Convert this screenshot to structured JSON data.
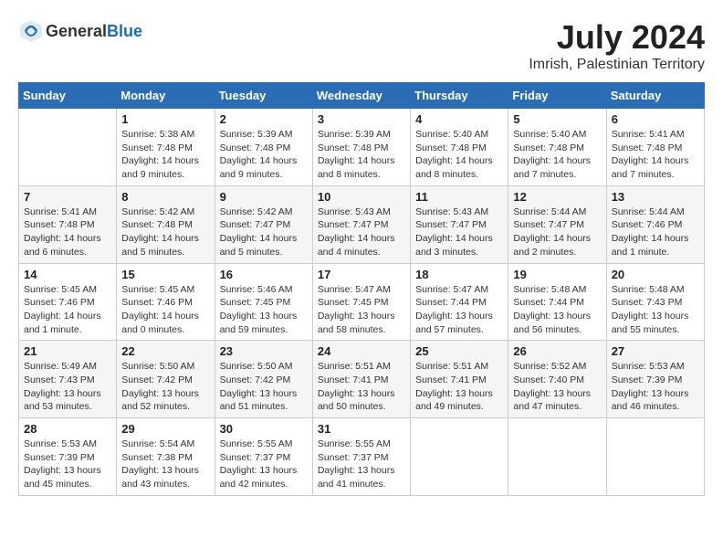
{
  "header": {
    "logo_general": "General",
    "logo_blue": "Blue",
    "month_year": "July 2024",
    "location": "Imrish, Palestinian Territory"
  },
  "weekdays": [
    "Sunday",
    "Monday",
    "Tuesday",
    "Wednesday",
    "Thursday",
    "Friday",
    "Saturday"
  ],
  "weeks": [
    [
      {
        "day": "",
        "sunrise": "",
        "sunset": "",
        "daylight": ""
      },
      {
        "day": "1",
        "sunrise": "Sunrise: 5:38 AM",
        "sunset": "Sunset: 7:48 PM",
        "daylight": "Daylight: 14 hours and 9 minutes."
      },
      {
        "day": "2",
        "sunrise": "Sunrise: 5:39 AM",
        "sunset": "Sunset: 7:48 PM",
        "daylight": "Daylight: 14 hours and 9 minutes."
      },
      {
        "day": "3",
        "sunrise": "Sunrise: 5:39 AM",
        "sunset": "Sunset: 7:48 PM",
        "daylight": "Daylight: 14 hours and 8 minutes."
      },
      {
        "day": "4",
        "sunrise": "Sunrise: 5:40 AM",
        "sunset": "Sunset: 7:48 PM",
        "daylight": "Daylight: 14 hours and 8 minutes."
      },
      {
        "day": "5",
        "sunrise": "Sunrise: 5:40 AM",
        "sunset": "Sunset: 7:48 PM",
        "daylight": "Daylight: 14 hours and 7 minutes."
      },
      {
        "day": "6",
        "sunrise": "Sunrise: 5:41 AM",
        "sunset": "Sunset: 7:48 PM",
        "daylight": "Daylight: 14 hours and 7 minutes."
      }
    ],
    [
      {
        "day": "7",
        "sunrise": "Sunrise: 5:41 AM",
        "sunset": "Sunset: 7:48 PM",
        "daylight": "Daylight: 14 hours and 6 minutes."
      },
      {
        "day": "8",
        "sunrise": "Sunrise: 5:42 AM",
        "sunset": "Sunset: 7:48 PM",
        "daylight": "Daylight: 14 hours and 5 minutes."
      },
      {
        "day": "9",
        "sunrise": "Sunrise: 5:42 AM",
        "sunset": "Sunset: 7:47 PM",
        "daylight": "Daylight: 14 hours and 5 minutes."
      },
      {
        "day": "10",
        "sunrise": "Sunrise: 5:43 AM",
        "sunset": "Sunset: 7:47 PM",
        "daylight": "Daylight: 14 hours and 4 minutes."
      },
      {
        "day": "11",
        "sunrise": "Sunrise: 5:43 AM",
        "sunset": "Sunset: 7:47 PM",
        "daylight": "Daylight: 14 hours and 3 minutes."
      },
      {
        "day": "12",
        "sunrise": "Sunrise: 5:44 AM",
        "sunset": "Sunset: 7:47 PM",
        "daylight": "Daylight: 14 hours and 2 minutes."
      },
      {
        "day": "13",
        "sunrise": "Sunrise: 5:44 AM",
        "sunset": "Sunset: 7:46 PM",
        "daylight": "Daylight: 14 hours and 1 minute."
      }
    ],
    [
      {
        "day": "14",
        "sunrise": "Sunrise: 5:45 AM",
        "sunset": "Sunset: 7:46 PM",
        "daylight": "Daylight: 14 hours and 1 minute."
      },
      {
        "day": "15",
        "sunrise": "Sunrise: 5:45 AM",
        "sunset": "Sunset: 7:46 PM",
        "daylight": "Daylight: 14 hours and 0 minutes."
      },
      {
        "day": "16",
        "sunrise": "Sunrise: 5:46 AM",
        "sunset": "Sunset: 7:45 PM",
        "daylight": "Daylight: 13 hours and 59 minutes."
      },
      {
        "day": "17",
        "sunrise": "Sunrise: 5:47 AM",
        "sunset": "Sunset: 7:45 PM",
        "daylight": "Daylight: 13 hours and 58 minutes."
      },
      {
        "day": "18",
        "sunrise": "Sunrise: 5:47 AM",
        "sunset": "Sunset: 7:44 PM",
        "daylight": "Daylight: 13 hours and 57 minutes."
      },
      {
        "day": "19",
        "sunrise": "Sunrise: 5:48 AM",
        "sunset": "Sunset: 7:44 PM",
        "daylight": "Daylight: 13 hours and 56 minutes."
      },
      {
        "day": "20",
        "sunrise": "Sunrise: 5:48 AM",
        "sunset": "Sunset: 7:43 PM",
        "daylight": "Daylight: 13 hours and 55 minutes."
      }
    ],
    [
      {
        "day": "21",
        "sunrise": "Sunrise: 5:49 AM",
        "sunset": "Sunset: 7:43 PM",
        "daylight": "Daylight: 13 hours and 53 minutes."
      },
      {
        "day": "22",
        "sunrise": "Sunrise: 5:50 AM",
        "sunset": "Sunset: 7:42 PM",
        "daylight": "Daylight: 13 hours and 52 minutes."
      },
      {
        "day": "23",
        "sunrise": "Sunrise: 5:50 AM",
        "sunset": "Sunset: 7:42 PM",
        "daylight": "Daylight: 13 hours and 51 minutes."
      },
      {
        "day": "24",
        "sunrise": "Sunrise: 5:51 AM",
        "sunset": "Sunset: 7:41 PM",
        "daylight": "Daylight: 13 hours and 50 minutes."
      },
      {
        "day": "25",
        "sunrise": "Sunrise: 5:51 AM",
        "sunset": "Sunset: 7:41 PM",
        "daylight": "Daylight: 13 hours and 49 minutes."
      },
      {
        "day": "26",
        "sunrise": "Sunrise: 5:52 AM",
        "sunset": "Sunset: 7:40 PM",
        "daylight": "Daylight: 13 hours and 47 minutes."
      },
      {
        "day": "27",
        "sunrise": "Sunrise: 5:53 AM",
        "sunset": "Sunset: 7:39 PM",
        "daylight": "Daylight: 13 hours and 46 minutes."
      }
    ],
    [
      {
        "day": "28",
        "sunrise": "Sunrise: 5:53 AM",
        "sunset": "Sunset: 7:39 PM",
        "daylight": "Daylight: 13 hours and 45 minutes."
      },
      {
        "day": "29",
        "sunrise": "Sunrise: 5:54 AM",
        "sunset": "Sunset: 7:38 PM",
        "daylight": "Daylight: 13 hours and 43 minutes."
      },
      {
        "day": "30",
        "sunrise": "Sunrise: 5:55 AM",
        "sunset": "Sunset: 7:37 PM",
        "daylight": "Daylight: 13 hours and 42 minutes."
      },
      {
        "day": "31",
        "sunrise": "Sunrise: 5:55 AM",
        "sunset": "Sunset: 7:37 PM",
        "daylight": "Daylight: 13 hours and 41 minutes."
      },
      {
        "day": "",
        "sunrise": "",
        "sunset": "",
        "daylight": ""
      },
      {
        "day": "",
        "sunrise": "",
        "sunset": "",
        "daylight": ""
      },
      {
        "day": "",
        "sunrise": "",
        "sunset": "",
        "daylight": ""
      }
    ]
  ]
}
